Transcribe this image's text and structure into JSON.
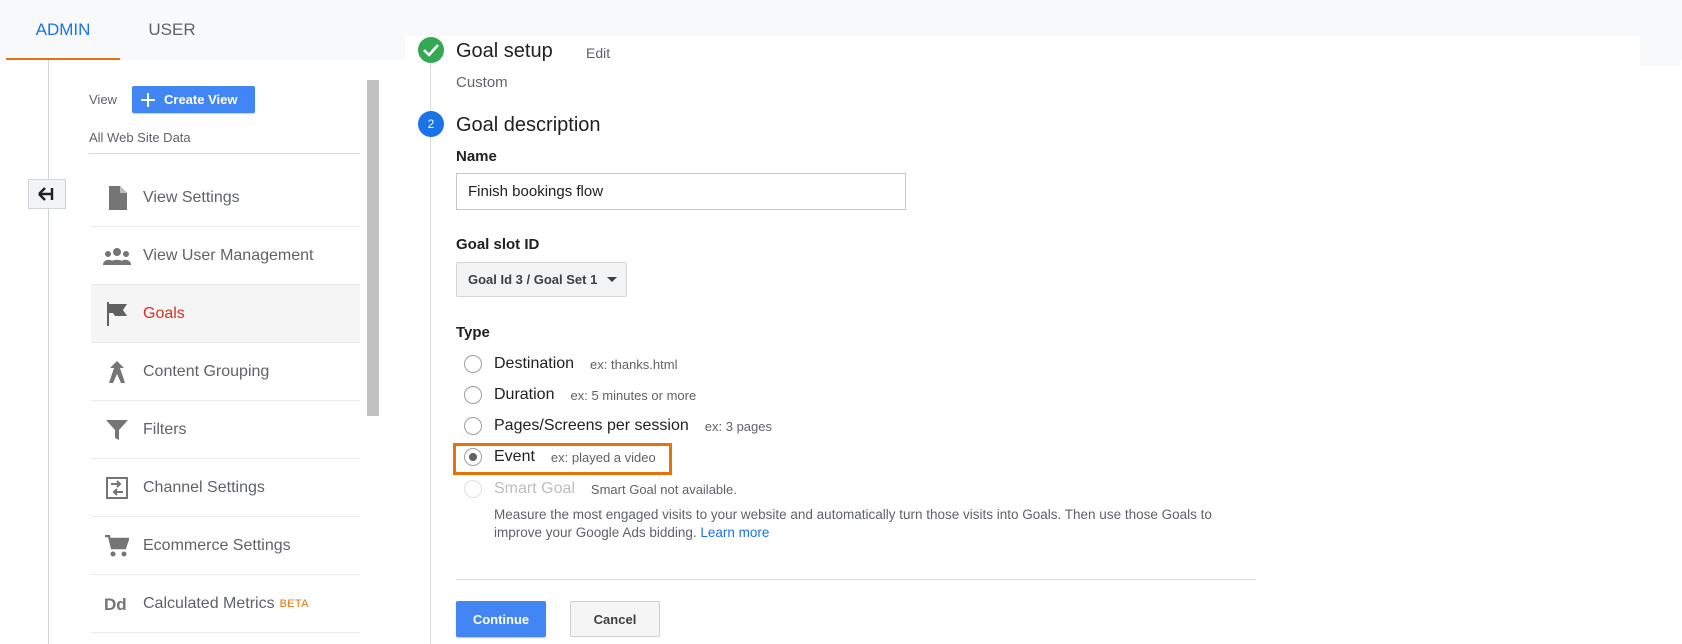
{
  "tabs": {
    "admin": "ADMIN",
    "user": "USER"
  },
  "view": {
    "label": "View",
    "create_button": "Create View",
    "current": "All Web Site Data"
  },
  "menu": {
    "items": [
      {
        "label": "View Settings",
        "icon": "document-icon"
      },
      {
        "label": "View User Management",
        "icon": "users-icon"
      },
      {
        "label": "Goals",
        "icon": "flag-icon",
        "active": true
      },
      {
        "label": "Content Grouping",
        "icon": "content-grouping-icon"
      },
      {
        "label": "Filters",
        "icon": "filter-icon"
      },
      {
        "label": "Channel Settings",
        "icon": "channel-settings-icon"
      },
      {
        "label": "Ecommerce Settings",
        "icon": "cart-icon"
      },
      {
        "label": "Calculated Metrics",
        "icon": "dd-icon",
        "badge": "BETA"
      }
    ]
  },
  "goal_setup": {
    "title": "Goal setup",
    "edit": "Edit",
    "value": "Custom"
  },
  "goal_description": {
    "step_number": "2",
    "title": "Goal description",
    "name_label": "Name",
    "name_value": "Finish bookings flow",
    "slot_label": "Goal slot ID",
    "slot_value": "Goal Id 3 / Goal Set 1",
    "type_label": "Type",
    "types": [
      {
        "label": "Destination",
        "example": "ex: thanks.html",
        "checked": false
      },
      {
        "label": "Duration",
        "example": "ex: 5 minutes or more",
        "checked": false
      },
      {
        "label": "Pages/Screens per session",
        "example": "ex: 3 pages",
        "checked": false
      },
      {
        "label": "Event",
        "example": "ex: played a video",
        "checked": true
      },
      {
        "label": "Smart Goal",
        "example": "Smart Goal not available.",
        "checked": false,
        "disabled": true
      }
    ],
    "smart_desc": "Measure the most engaged visits to your website and automatically turn those visits into Goals. Then use those Goals to improve your Google Ads bidding.",
    "learn_more": "Learn more"
  },
  "actions": {
    "continue": "Continue",
    "cancel": "Cancel"
  },
  "colors": {
    "accent": "#1a73e8",
    "button_blue": "#4285f4",
    "highlight_orange": "#e8710a",
    "active_red": "#d93025",
    "success_green": "#34a853"
  }
}
